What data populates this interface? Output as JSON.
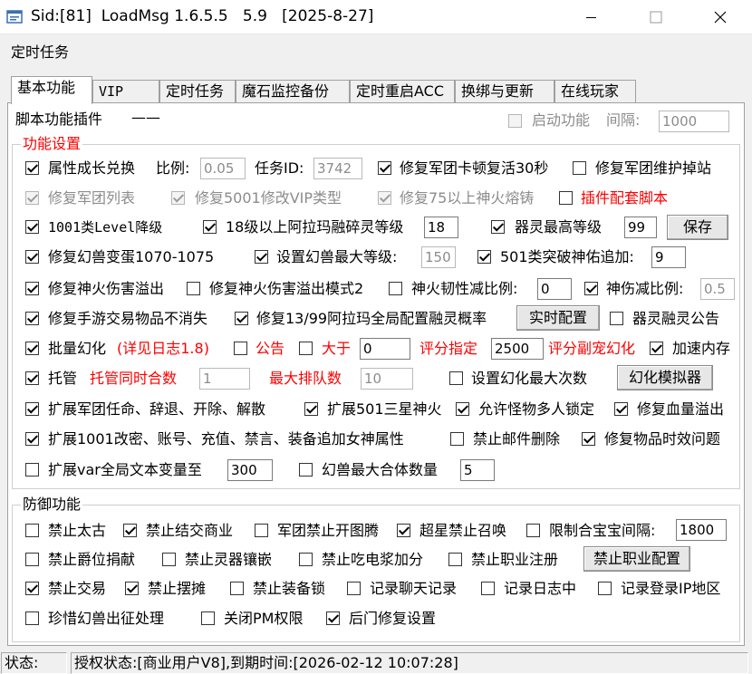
{
  "window": {
    "title": "Sid:[81]  LoadMsg 1.6.5.5   5.9   [2025-8-27]",
    "minimize_icon": "minimize-icon",
    "maximize_icon": "maximize-icon",
    "close_icon": "close-icon"
  },
  "menu": {
    "item": "定时任务"
  },
  "tabs": [
    "基本功能",
    "VIP",
    "定时任务",
    "魔石监控备份",
    "定时重启ACC",
    "换绑与更新",
    "在线玩家"
  ],
  "plugin": {
    "label": "脚本功能插件",
    "dash": "——",
    "enable_label": "启动功能",
    "interval_label": "间隔:",
    "interval_value": "1000"
  },
  "settings": {
    "title": "功能设置",
    "r1": {
      "a": "属性成长兑换",
      "ratio_label": "比例:",
      "ratio_value": "0.05",
      "task_label": "任务ID:",
      "task_value": "3742",
      "b": "修复军团卡顿复活30秒",
      "c": "修复军团维护掉站"
    },
    "r2": {
      "a": "修复军团列表",
      "b": "修复5001修改VIP类型",
      "c": "修复75以上神火熔铸",
      "d": "插件配套脚本"
    },
    "r3": {
      "a": "1001类Level降级",
      "b": "18级以上阿拉玛融碎灵等级",
      "b_value": "18",
      "c": "器灵最高等级",
      "c_value": "99",
      "save": "保存"
    },
    "r4": {
      "a": "修复幻兽变蛋1070-1075",
      "b": "设置幻兽最大等级:",
      "b_value": "150",
      "c": "501类突破神佑追加:",
      "c_value": "9"
    },
    "r5": {
      "a": "修复神火伤害溢出",
      "b": "修复神火伤害溢出模式2",
      "c": "神火韧性减比例:",
      "c_value": "0",
      "d": "神伤减比例:",
      "d_value": "0.5"
    },
    "r6": {
      "a": "修复手游交易物品不消失",
      "b": "修复13/99阿拉玛全局配置融灵概率",
      "btn": "实时配置",
      "c": "器灵融灵公告"
    },
    "r7": {
      "a": "批量幻化",
      "a_note": "(详见日志1.8)",
      "b": "公告",
      "c": "大于",
      "c_value": "0",
      "score_label": "评分指定",
      "score_value": "2500",
      "d": "评分副宠幻化",
      "e": "加速内存"
    },
    "r8": {
      "a": "托管",
      "b": "托管同时合数",
      "b_value": "1",
      "c": "最大排队数",
      "c_value": "10",
      "d": "设置幻化最大次数",
      "btn": "幻化模拟器"
    },
    "r9": {
      "a": "扩展军团任命、辞退、开除、解散",
      "b": "扩展501三星神火",
      "c": "允许怪物多人锁定",
      "d": "修复血量溢出"
    },
    "r10": {
      "a": "扩展1001改密、账号、充值、禁言、装备追加女神属性",
      "b": "禁止邮件删除",
      "c": "修复物品时效问题"
    },
    "r11": {
      "a": "扩展var全局文本变量至",
      "a_value": "300",
      "b": "幻兽最大合体数量",
      "b_value": "5"
    }
  },
  "defense": {
    "title": "防御功能",
    "r1": {
      "a": "禁止太古",
      "b": "禁止结交商业",
      "c": "军团禁止开图腾",
      "d": "超星禁止召唤",
      "e": "限制合宝宝间隔:",
      "e_value": "1800"
    },
    "r2": {
      "a": "禁止爵位捐献",
      "b": "禁止灵器镶嵌",
      "c": "禁止吃电浆加分",
      "d": "禁止职业注册",
      "btn": "禁止职业配置"
    },
    "r3": {
      "a": "禁止交易",
      "b": "禁止摆摊",
      "c": "禁止装备锁",
      "d": "记录聊天记录",
      "e": "记录日志中",
      "f": "记录登录IP地区"
    },
    "r4": {
      "a": "珍惜幻兽出征处理",
      "b": "关闭PM权限",
      "c": "后门修复设置"
    }
  },
  "status": {
    "label": "状态:",
    "auth": "授权状态:[商业用户V8],到期时间:[2026-02-12 10:07:28]"
  },
  "colors": {
    "accent_red": "#ff0000",
    "panel_bg": "#ffffff",
    "window_bg": "#f0f0f0"
  }
}
